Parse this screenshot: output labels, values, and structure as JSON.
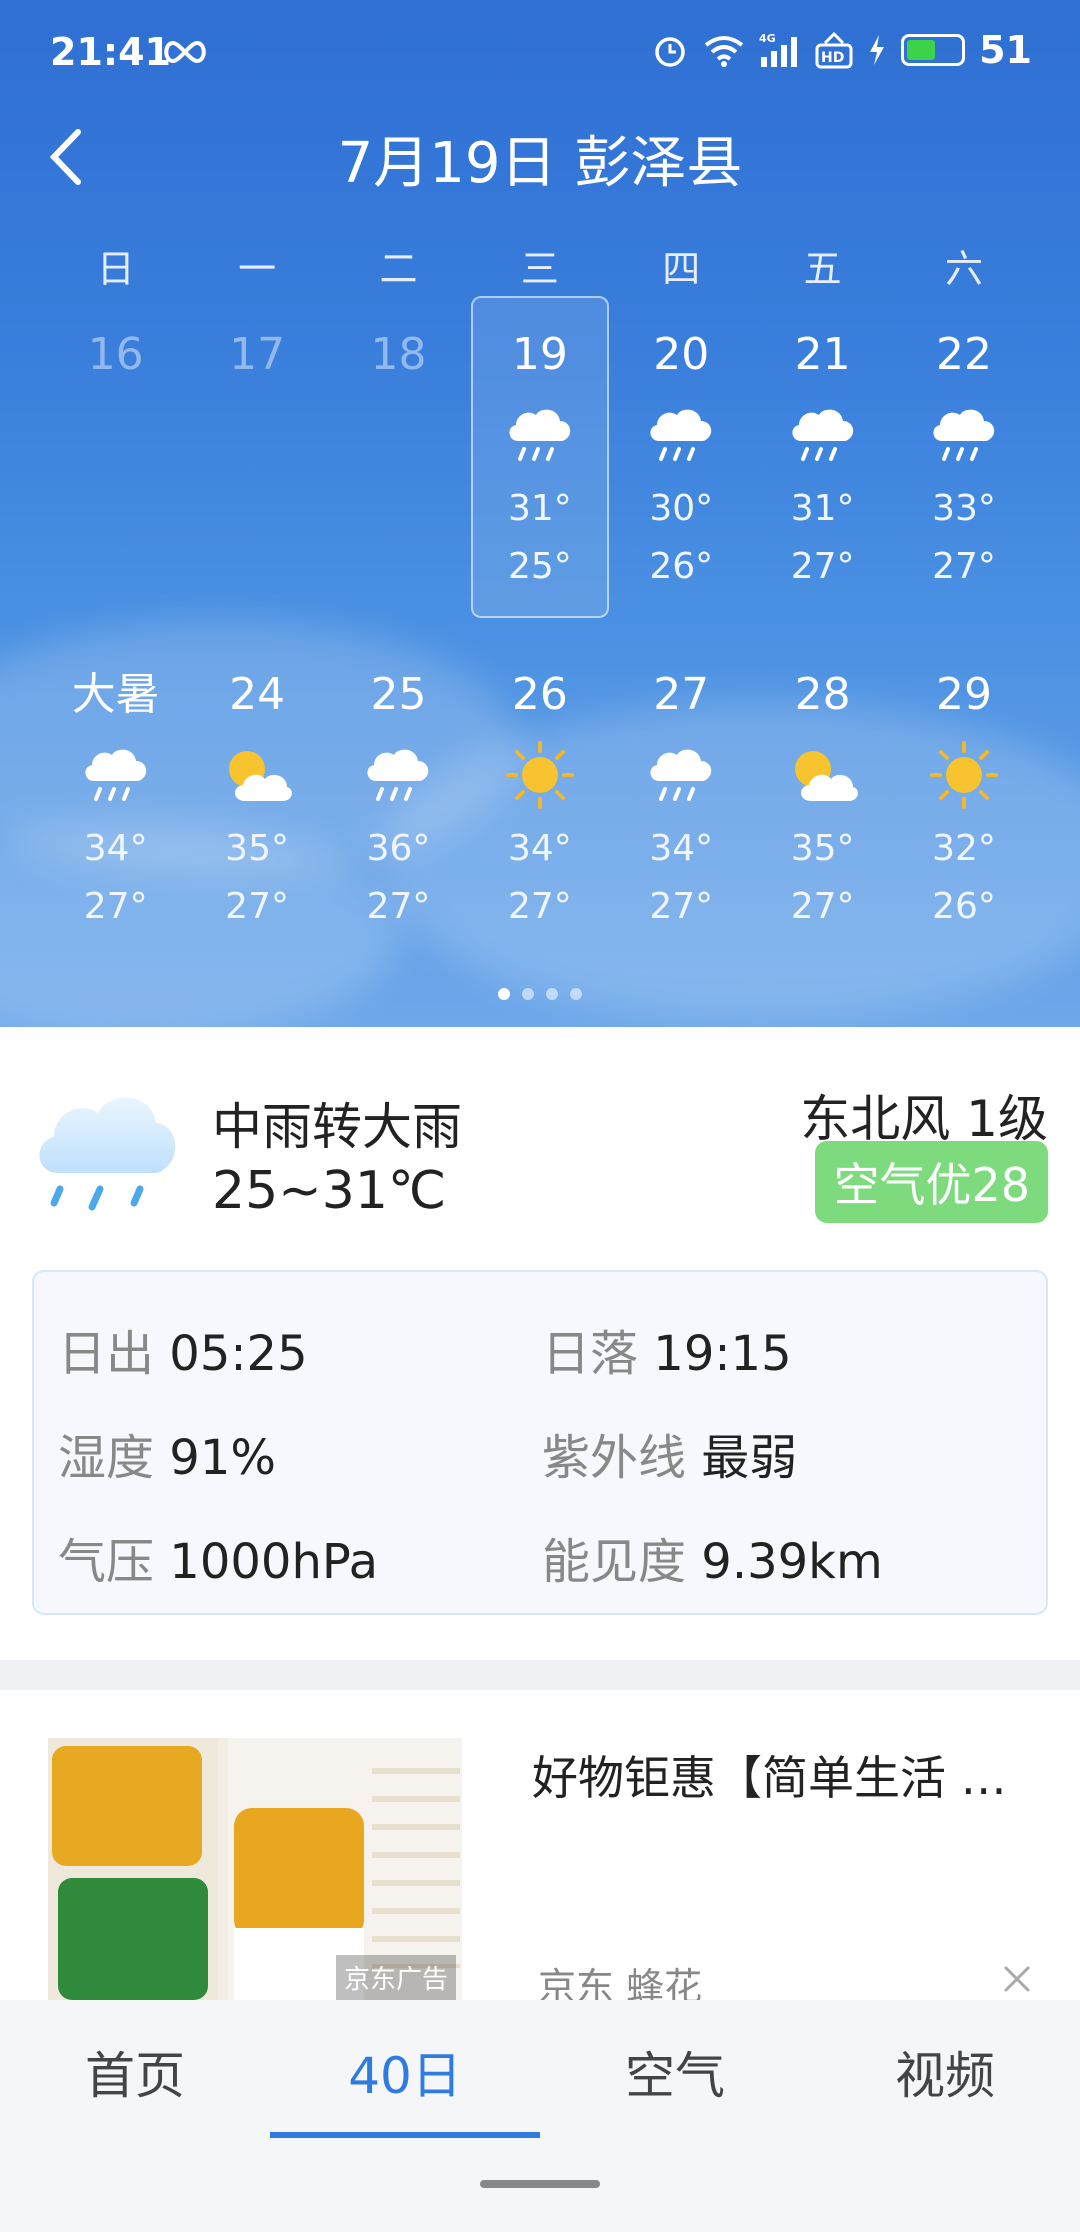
{
  "status": {
    "time": "21:41",
    "battery": "51"
  },
  "header": {
    "title": "7月19日 彭泽县"
  },
  "weekdays": [
    "日",
    "一",
    "二",
    "三",
    "四",
    "五",
    "六"
  ],
  "week1": [
    {
      "date": "16",
      "past": true
    },
    {
      "date": "17",
      "past": true
    },
    {
      "date": "18",
      "past": true
    },
    {
      "date": "19",
      "icon": "rain-cloud-icon",
      "high": "31°",
      "low": "25°",
      "selected": true
    },
    {
      "date": "20",
      "icon": "rain-cloud-icon",
      "high": "30°",
      "low": "26°"
    },
    {
      "date": "21",
      "icon": "rain-cloud-icon",
      "high": "31°",
      "low": "27°"
    },
    {
      "date": "22",
      "icon": "rain-cloud-icon",
      "high": "33°",
      "low": "27°"
    }
  ],
  "week2": [
    {
      "date": "大暑",
      "icon": "rain-cloud-icon",
      "high": "34°",
      "low": "27°"
    },
    {
      "date": "24",
      "icon": "partly-cloudy-icon",
      "high": "35°",
      "low": "27°"
    },
    {
      "date": "25",
      "icon": "rain-cloud-icon",
      "high": "36°",
      "low": "27°"
    },
    {
      "date": "26",
      "icon": "sun-icon",
      "high": "34°",
      "low": "27°"
    },
    {
      "date": "27",
      "icon": "rain-cloud-icon",
      "high": "34°",
      "low": "27°"
    },
    {
      "date": "28",
      "icon": "partly-cloudy-icon",
      "high": "35°",
      "low": "27°"
    },
    {
      "date": "29",
      "icon": "sun-icon",
      "high": "32°",
      "low": "26°"
    }
  ],
  "today": {
    "condition": "中雨转大雨",
    "range": "25~31℃",
    "wind": "东北风 1级",
    "aqi": "空气优28"
  },
  "details": {
    "sunrise_label": "日出",
    "sunrise": "05:25",
    "sunset_label": "日落",
    "sunset": "19:15",
    "humidity_label": "湿度",
    "humidity": "91%",
    "uv_label": "紫外线",
    "uv": "最弱",
    "pressure_label": "气压",
    "pressure": "1000hPa",
    "visibility_label": "能见度",
    "visibility": "9.39km"
  },
  "ad": {
    "title": "好物钜惠【简单生活 购物上京东】",
    "source": "京东 蜂花",
    "tag": "京东广告",
    "brand": "蜂花"
  },
  "nav": {
    "tabs": [
      "首页",
      "40日",
      "空气",
      "视频"
    ],
    "active": 1
  },
  "colors": {
    "accent": "#2f7be0",
    "aqi_green": "#7ddb7d",
    "sky": "#3a7fdc"
  }
}
